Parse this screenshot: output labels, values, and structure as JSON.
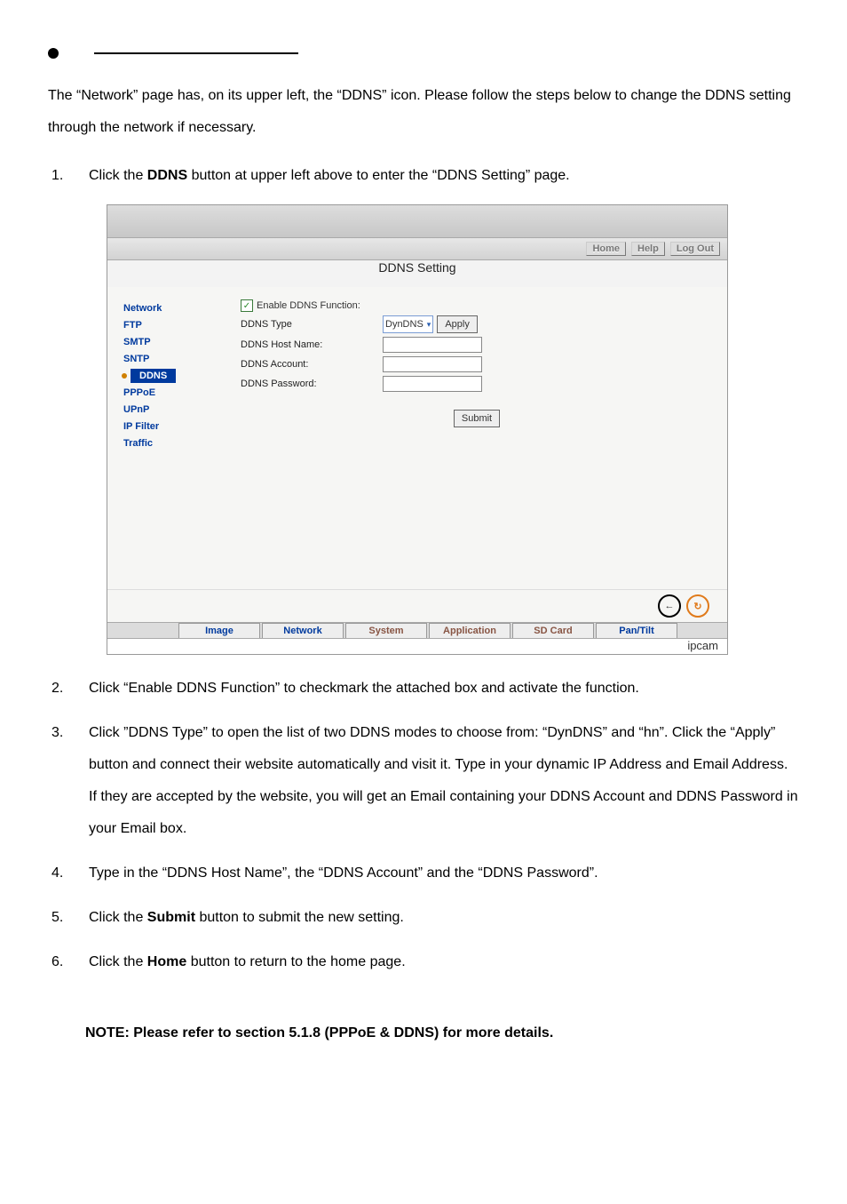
{
  "intro": "The “Network” page has, on its upper left, the “DDNS” icon. Please follow the steps below to change the DDNS setting through the network if necessary.",
  "steps": {
    "s1_a": "Click the ",
    "s1_b": "DDNS",
    "s1_c": " button at upper left above to enter the “DDNS Setting” page.",
    "s2": "Click “Enable DDNS Function” to checkmark the attached box and activate the function.",
    "s3": "Click ”DDNS Type” to open the list of two DDNS modes to choose from: “DynDNS” and “hn”. Click the “Apply” button and connect their website automatically and visit it. Type in your dynamic IP Address and Email Address. If they are accepted by the website, you will get an Email containing your DDNS Account and DDNS Password in your Email box.",
    "s4": "Type in the “DDNS Host Name”, the “DDNS Account” and the “DDNS Password”.",
    "s5_a": "Click the ",
    "s5_b": "Submit",
    "s5_c": " button to submit the new setting.",
    "s6_a": "Click the ",
    "s6_b": "Home",
    "s6_c": " button to return to the home page."
  },
  "note": "NOTE: Please refer to section 5.1.8 (PPPoE & DDNS) for more details.",
  "shot": {
    "links": {
      "home": "Home",
      "help": "Help",
      "logout": "Log Out"
    },
    "title": "DDNS Setting",
    "sidebar": [
      "Network",
      "FTP",
      "SMTP",
      "SNTP",
      "DDNS",
      "PPPoE",
      "UPnP",
      "IP Filter",
      "Traffic"
    ],
    "form": {
      "enable": "Enable DDNS Function:",
      "type_lbl": "DDNS Type",
      "type_val": "DynDNS",
      "apply": "Apply",
      "host": "DDNS Host Name:",
      "acct": "DDNS Account:",
      "pwd": "DDNS Password:",
      "submit": "Submit"
    },
    "tabs": [
      "Image",
      "Network",
      "System",
      "Application",
      "SD Card",
      "Pan/Tilt"
    ],
    "brand": "ipcam"
  },
  "nums": {
    "n1": "1.",
    "n2": "2.",
    "n3": "3.",
    "n4": "4.",
    "n5": "5.",
    "n6": "6."
  }
}
